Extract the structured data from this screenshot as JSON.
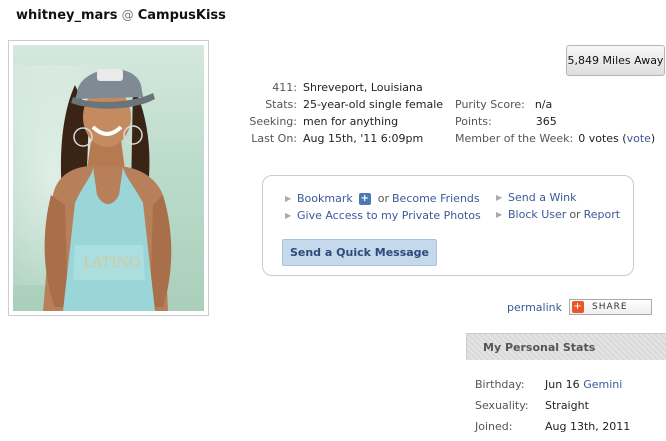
{
  "header": {
    "username": "whitney_mars",
    "at": "@",
    "site": "CampusKiss"
  },
  "distance_button": "5,849 Miles Away",
  "profile": {
    "rows": [
      {
        "label": "411:",
        "value": "Shreveport, Louisiana"
      },
      {
        "label": "Stats:",
        "value": "25-year-old single female"
      },
      {
        "label": "Seeking:",
        "value": "men for anything"
      },
      {
        "label": "Last On:",
        "value": "Aug 15th, '11 6:09pm"
      }
    ],
    "purity_label": "Purity Score:",
    "purity_value": "n/a",
    "points_label": "Points:",
    "points_value": "365",
    "motw_label": "Member of the Week:",
    "motw_value": "0 votes",
    "motw_open": "(",
    "motw_vote": "vote",
    "motw_close": ")"
  },
  "actions": {
    "bookmark": "Bookmark",
    "or1": "or",
    "become_friends": "Become Friends",
    "give_access": "Give Access to my Private Photos",
    "send_wink": "Send a Wink",
    "block_user": "Block User",
    "or2": "or",
    "report": "Report",
    "quick_message": "Send a Quick Message"
  },
  "permalink": "permalink",
  "share": "SHARE",
  "personal_stats": {
    "title": "My Personal Stats",
    "birthday_label": "Birthday:",
    "birthday_value": "Jun 16",
    "birthday_sign": "Gemini",
    "sexuality_label": "Sexuality:",
    "sexuality_value": "Straight",
    "joined_label": "Joined:",
    "joined_value": "Aug 13th, 2011"
  },
  "icons": {
    "bookmark_plus": "plus-icon",
    "share": "share-icon",
    "bullet": "triangle-bullet-icon"
  }
}
